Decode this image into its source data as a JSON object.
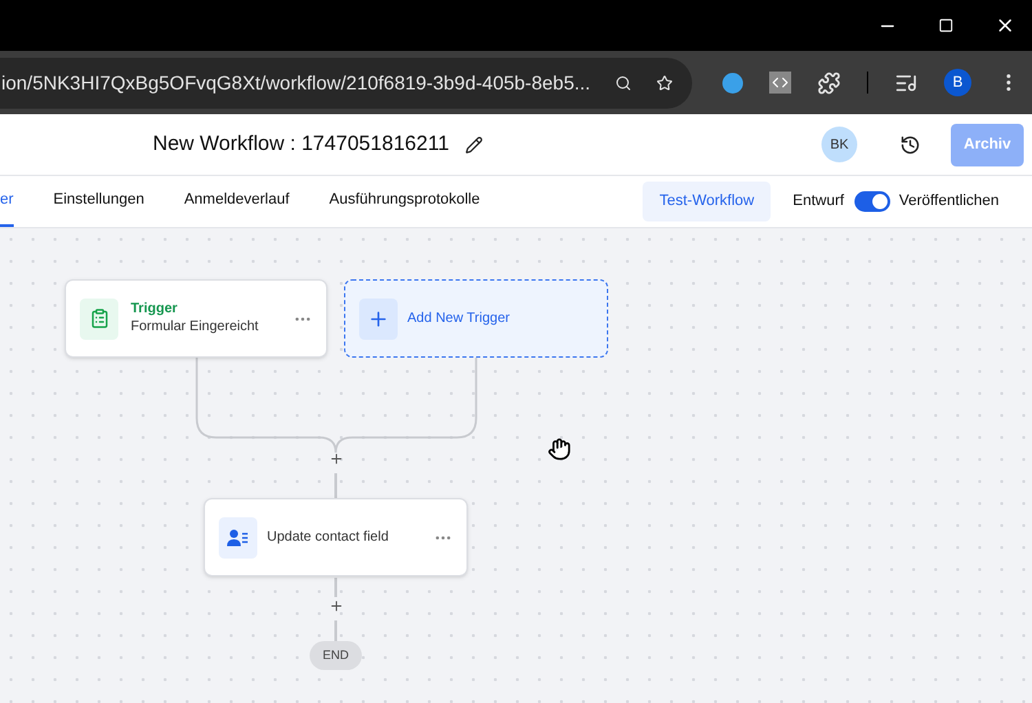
{
  "browser": {
    "url": "ion/5NK3HI7QxBg5OFvqG8Xt/workflow/210f6819-3b9d-405b-8eb5...",
    "profile": "B"
  },
  "header": {
    "title": "New Workflow : 1747051816211",
    "avatar": "BK",
    "archive_button": "Archiv"
  },
  "tabs": [
    {
      "label": "er",
      "selected": true
    },
    {
      "label": "Einstellungen",
      "selected": false
    },
    {
      "label": "Anmeldeverlauf",
      "selected": false
    },
    {
      "label": "Ausführungsprotokolle",
      "selected": false
    }
  ],
  "test_button": "Test-Workflow",
  "publish_toggle": {
    "off_label": "Entwurf",
    "on": true,
    "on_label": "Veröffentlichen"
  },
  "triggers": [
    {
      "kind": "trigger",
      "title": "Trigger",
      "subtitle": "Formular Eingereicht"
    },
    {
      "kind": "add",
      "title": "Add New Trigger"
    }
  ],
  "actions": [
    {
      "title": "Update contact field"
    }
  ],
  "end_label": "END"
}
